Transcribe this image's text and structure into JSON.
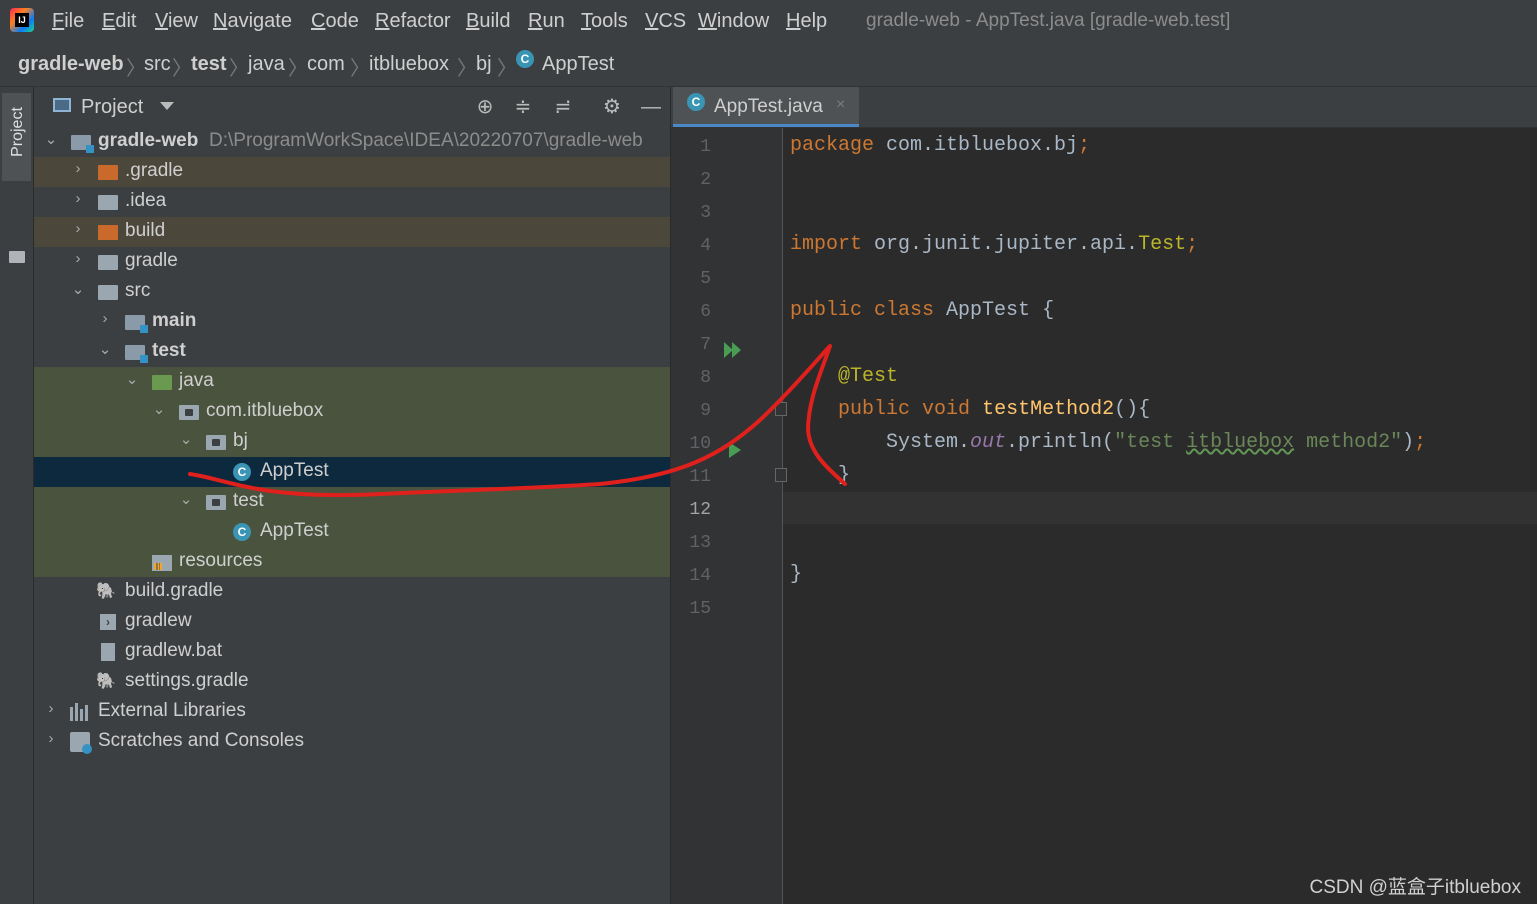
{
  "menubar": {
    "items": [
      "File",
      "Edit",
      "View",
      "Navigate",
      "Code",
      "Refactor",
      "Build",
      "Run",
      "Tools",
      "VCS",
      "Window",
      "Help"
    ],
    "window_title": "gradle-web - AppTest.java [gradle-web.test]",
    "logo_icon": "intellij-idea-logo",
    "logo_text": "IJ"
  },
  "breadcrumb": [
    "gradle-web",
    "src",
    "test",
    "java",
    "com",
    "itbluebox",
    "bj",
    "AppTest"
  ],
  "sidebar_strip": {
    "label": "Project"
  },
  "project_panel": {
    "title": "Project",
    "toolbar_icons": [
      "crosshair-icon",
      "expand-all-icon",
      "collapse-all-icon",
      "gear-icon",
      "minimize-icon"
    ],
    "tree": [
      {
        "label": "gradle-web",
        "path": "D:\\ProgramWorkSpace\\IDEA\\20220707\\gradle-web"
      },
      {
        "label": ".gradle"
      },
      {
        "label": ".idea"
      },
      {
        "label": "build"
      },
      {
        "label": "gradle"
      },
      {
        "label": "src"
      },
      {
        "label": "main"
      },
      {
        "label": "test"
      },
      {
        "label": "java"
      },
      {
        "label": "com.itbluebox"
      },
      {
        "label": "bj"
      },
      {
        "label": "AppTest"
      },
      {
        "label": "test"
      },
      {
        "label": "AppTest"
      },
      {
        "label": "resources"
      },
      {
        "label": "build.gradle"
      },
      {
        "label": "gradlew"
      },
      {
        "label": "gradlew.bat"
      },
      {
        "label": "settings.gradle"
      },
      {
        "label": "External Libraries"
      },
      {
        "label": "Scratches and Consoles"
      }
    ]
  },
  "editor": {
    "tab": {
      "label": "AppTest.java",
      "close": "×"
    },
    "line_numbers": [
      "1",
      "2",
      "3",
      "4",
      "5",
      "6",
      "7",
      "8",
      "9",
      "10",
      "11",
      "12",
      "13",
      "14",
      "15"
    ],
    "current_line": "12",
    "code": {
      "l1_kw": "package",
      "l1_rest": " com.itbluebox.bj",
      "l4_kw": "import",
      "l4_rest": " org.junit.jupiter.api.",
      "l4_cls": "Test",
      "l6_kw1": "public",
      "l6_kw2": "class",
      "l6_rest": " AppTest {",
      "l8_ann": "@Test",
      "l9_kw1": "public",
      "l9_kw2": "void",
      "l9_fn": "testMethod2",
      "l9_rest": "(){",
      "l10_a": "System.",
      "l10_fld": "out",
      "l10_b": ".println(",
      "l10_str1": "\"test ",
      "l10_str2": "itbluebox",
      "l10_str3": " method2\"",
      "l10_c": ")",
      "l11": "}",
      "l14": "}",
      "semicolon": ";"
    }
  },
  "watermark": "CSDN @蓝盒子itbluebox",
  "colors": {
    "menubar_bg": "#3c3f41",
    "editor_bg": "#2b2b2b",
    "selection": "#0d293e",
    "ignored_bg": "#4c473b",
    "test_bg": "#49533d",
    "annotation_stroke": "#e0201c"
  }
}
